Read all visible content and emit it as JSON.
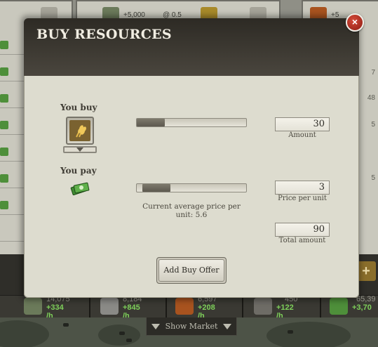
{
  "background": {
    "market_top_values": [
      "+5,000",
      "@ 0.5",
      "+5"
    ],
    "market_side_values": [
      "7",
      "48",
      "5",
      "5"
    ],
    "resources": [
      {
        "total": "14,075",
        "rate": "+334 /h",
        "icon": "soldier-icon",
        "color": "#6b7a5a"
      },
      {
        "total": "8,184",
        "rate": "+845 /h",
        "icon": "steel-beam-icon",
        "color": "#8a8a86"
      },
      {
        "total": "6,597",
        "rate": "+208 /h",
        "icon": "oil-barrel-icon",
        "color": "#a8531f"
      },
      {
        "total": "450",
        "rate": "+122 /h",
        "icon": "machinery-icon",
        "color": "#6e6c66"
      },
      {
        "total": "65,39",
        "rate": "+3,70",
        "icon": "money-icon",
        "color": "#4e8f3a"
      }
    ],
    "plus_label": "+",
    "show_market_label": "Show Market"
  },
  "dialog": {
    "title": "BUY RESOURCES",
    "close_label": "×",
    "you_buy_label": "You buy",
    "you_pay_label": "You pay",
    "buy_resource_icon": "grain-icon",
    "pay_resource_icon": "money-icon",
    "amount": {
      "value": "30",
      "label": "Amount",
      "slider_fraction": 0.23
    },
    "price_per_unit": {
      "value": "3",
      "label": "Price per unit",
      "slider_fraction": 0.23
    },
    "total_amount": {
      "value": "90",
      "label": "Total amount"
    },
    "average_price_text": "Current average price per unit: 5.6",
    "add_offer_label": "Add Buy Offer"
  },
  "colors": {
    "header_dark": "#2d2a24",
    "panel": "#dddccf",
    "close_red": "#c0392b",
    "rate_green": "#7ed05a"
  }
}
